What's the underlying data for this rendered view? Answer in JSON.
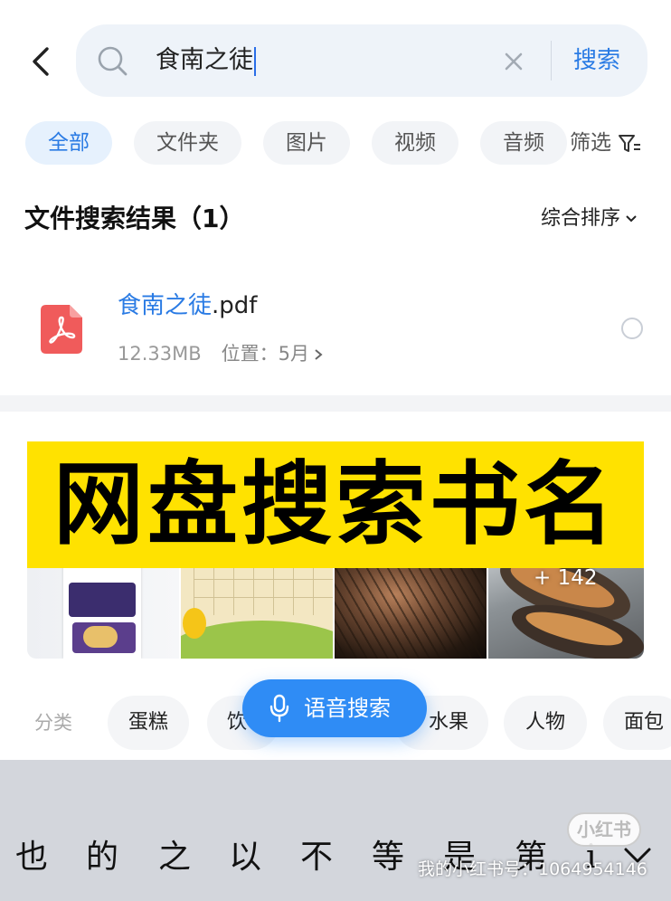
{
  "search": {
    "query": "食南之徒",
    "action_label": "搜索"
  },
  "tabs": [
    {
      "label": "全部",
      "active": true
    },
    {
      "label": "文件夹",
      "active": false
    },
    {
      "label": "图片",
      "active": false
    },
    {
      "label": "视频",
      "active": false
    },
    {
      "label": "音频",
      "active": false
    }
  ],
  "filter_label": "筛选",
  "results": {
    "title": "文件搜索结果（1）",
    "sort_label": "综合排序"
  },
  "file": {
    "name_highlight": "食南之徒",
    "name_ext": ".pdf",
    "size": "12.33MB",
    "location": "位置：5月"
  },
  "banner": {
    "text": "网盘搜索书名"
  },
  "image_strip": {
    "more_count": "+ 142"
  },
  "categories": {
    "label": "分类",
    "items": [
      "蛋糕",
      "饮",
      "水果",
      "人物",
      "面包"
    ]
  },
  "voice_search": {
    "label": "语音搜索"
  },
  "keyboard": {
    "suggestions": [
      "也",
      "的",
      "之",
      "以",
      "不",
      "等",
      "是",
      "第",
      "i"
    ]
  },
  "watermark": {
    "logo": "小红书",
    "text": "我的小红书号：1064954146"
  },
  "colors": {
    "accent": "#2a7be4",
    "banner_bg": "#ffe200",
    "voice_btn": "#2f8cf5",
    "keyboard_bg": "#d3d6dc",
    "pdf_red": "#f05b5b"
  }
}
